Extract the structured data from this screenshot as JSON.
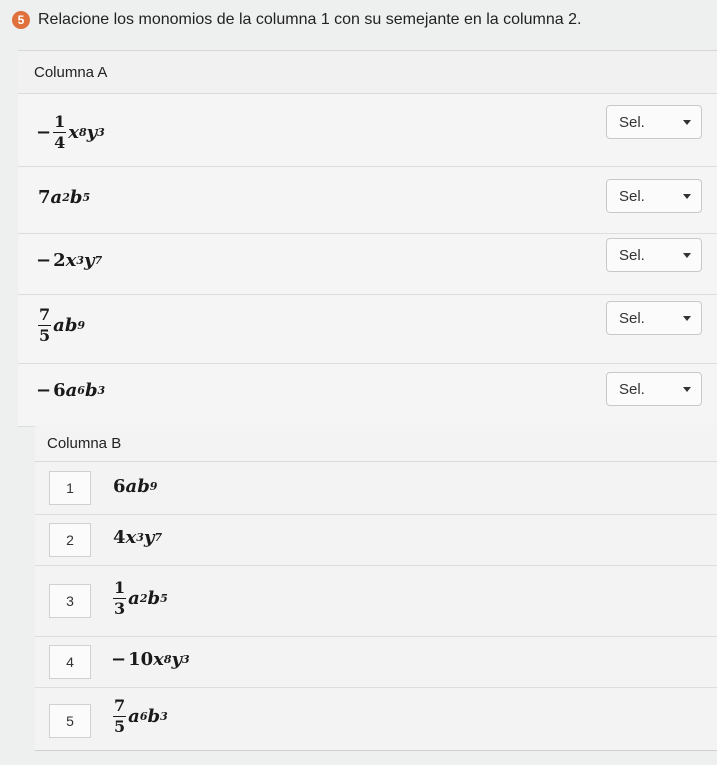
{
  "question": {
    "number": "5",
    "text": "Relacione los monomios de la columna 1 con su semejante en la columna 2."
  },
  "column_a": {
    "title": "Columna A",
    "items": [
      {
        "sign": "−",
        "frac_num": "1",
        "frac_den": "4",
        "coef": "",
        "v1": "x",
        "e1": "8",
        "v2": "y",
        "e2": "3",
        "select": "Sel."
      },
      {
        "sign": "",
        "frac_num": "",
        "frac_den": "",
        "coef": "7",
        "v1": "a",
        "e1": "2",
        "v2": "b",
        "e2": "5",
        "select": "Sel."
      },
      {
        "sign": "−",
        "frac_num": "",
        "frac_den": "",
        "coef": "2",
        "v1": "x",
        "e1": "3",
        "v2": "y",
        "e2": "7",
        "select": "Sel."
      },
      {
        "sign": "",
        "frac_num": "7",
        "frac_den": "5",
        "coef": "",
        "v1": "a",
        "e1": "",
        "v2": "b",
        "e2": "9",
        "select": "Sel."
      },
      {
        "sign": "−",
        "frac_num": "",
        "frac_den": "",
        "coef": "6",
        "v1": "a",
        "e1": "6",
        "v2": "b",
        "e2": "3",
        "select": "Sel."
      }
    ]
  },
  "column_b": {
    "title": "Columna B",
    "items": [
      {
        "num": "1",
        "sign": "",
        "frac_num": "",
        "frac_den": "",
        "coef": "6",
        "v1": "a",
        "e1": "",
        "v2": "b",
        "e2": "9"
      },
      {
        "num": "2",
        "sign": "",
        "frac_num": "",
        "frac_den": "",
        "coef": "4",
        "v1": "x",
        "e1": "3",
        "v2": "y",
        "e2": "7"
      },
      {
        "num": "3",
        "sign": "",
        "frac_num": "1",
        "frac_den": "3",
        "coef": "",
        "v1": "a",
        "e1": "2",
        "v2": "b",
        "e2": "5"
      },
      {
        "num": "4",
        "sign": "−",
        "frac_num": "",
        "frac_den": "",
        "coef": "10",
        "v1": "x",
        "e1": "8",
        "v2": "y",
        "e2": "3"
      },
      {
        "num": "5",
        "sign": "",
        "frac_num": "7",
        "frac_den": "5",
        "coef": "",
        "v1": "a",
        "e1": "6",
        "v2": "b",
        "e2": "3"
      }
    ]
  }
}
